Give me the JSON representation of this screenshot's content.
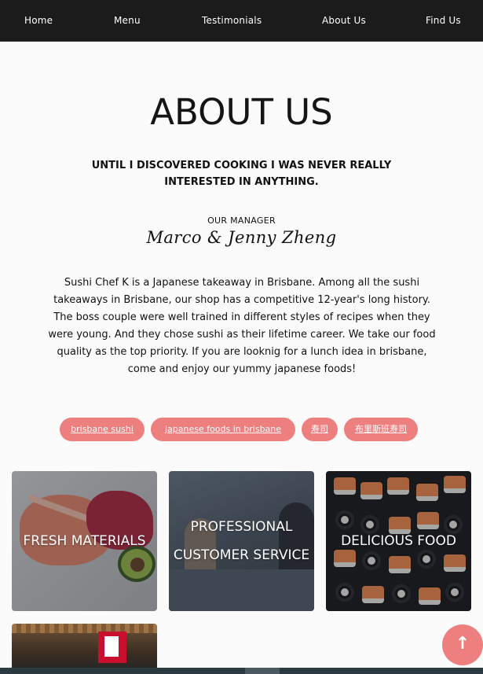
{
  "nav": {
    "items": [
      "Home",
      "Menu",
      "Testimonials",
      "About Us",
      "Find Us"
    ]
  },
  "about": {
    "title": "ABOUT US",
    "subtitle": "UNTIL I DISCOVERED COOKING I WAS NEVER REALLY INTERESTED IN ANYTHING.",
    "manager_label": "OUR MANAGER",
    "manager_name": "Marco & Jenny Zheng",
    "description": "Sushi Chef K is a Japanese takeaway in Brisbane. Among all the sushi takeaways in Brisbane, our shop has a competitive 12-year's long history. The boss couple were well trained in different styles of recipes when they were young. And they chose sushi as their lifetime career. We take our food quality as the top priority. If you are looknig for a lunch idea in brisbane, come and enjoy our yummy japanese foods!"
  },
  "tags": [
    "brisbane sushi",
    "japanese foods in brisbane",
    "寿司",
    "布里斯班寿司"
  ],
  "features": {
    "fresh": "FRESH MATERIALS",
    "service": "PROFESSIONAL CUSTOMER SERVICE",
    "delicious": "DELICIOUS FOOD"
  },
  "scroll_top_icon": "arrow-up-icon",
  "colors": {
    "accent": "#ee7f7f",
    "nav_bg": "#1b1b1b"
  }
}
